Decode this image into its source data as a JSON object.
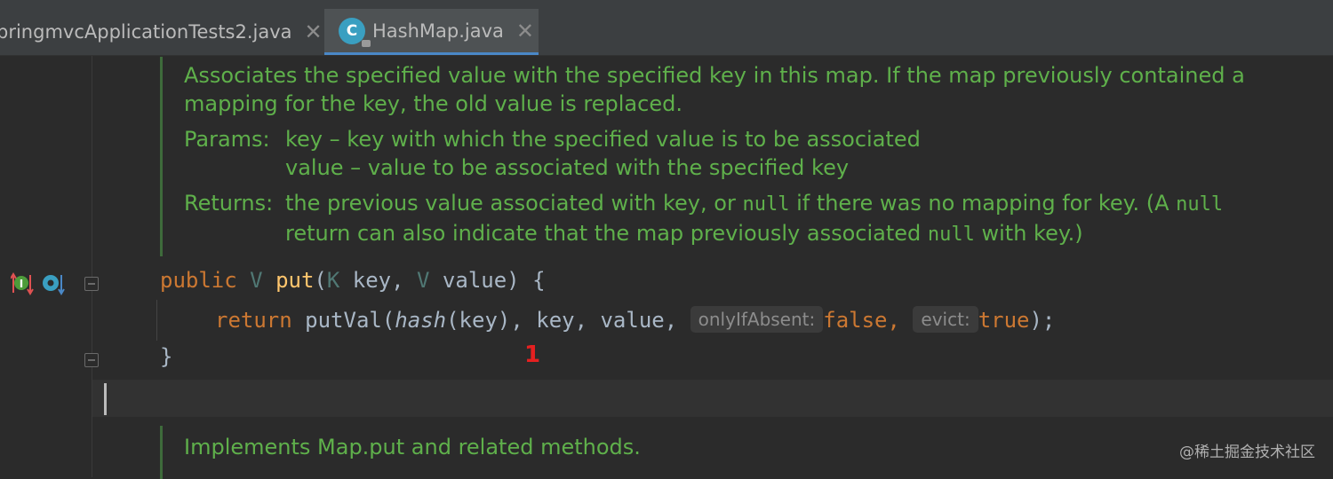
{
  "tabs": [
    {
      "label": "pringmvcApplicationTests2.java",
      "close": "✕"
    },
    {
      "label": "HashMap.java",
      "icon": "C",
      "close": "✕"
    }
  ],
  "doc1": {
    "line1": "Associates the specified value with the specified key in this map. If the map previously contained a",
    "line2": "mapping for the key, the old value is replaced.",
    "params_label": "Params:",
    "param1": "key – key with which the specified value is to be associated",
    "param2": "value – value to be associated with the specified key",
    "returns_label": "Returns:",
    "returns1_a": "the previous value associated with key, or ",
    "null1": "null",
    "returns1_b": " if there was no mapping for key. (A ",
    "null2": "null",
    "returns2_a": "return can also indicate that the map previously associated ",
    "null3": "null",
    "returns2_b": " with key.)"
  },
  "code": {
    "l1_public": "public",
    "l1_V": "V",
    "l1_put": "put",
    "l1_open": "(",
    "l1_K": "K",
    "l1_key": " key, ",
    "l1_V2": "V",
    "l1_rest": " value) {",
    "l2_return": "return",
    "l2_putVal": " putVal(",
    "l2_hash": "hash",
    "l2_args": "(key), key, value, ",
    "hint1": "onlyIfAbsent:",
    "l2_false": "false",
    "l2_comma": ", ",
    "hint2": "evict:",
    "l2_true": "true",
    "l2_end": ");",
    "l3_close": "}"
  },
  "marker": "1",
  "doc2": {
    "line1": "Implements Map.put and related methods."
  },
  "watermark": "@稀土掘金技术社区",
  "colors": {
    "doc": "#5fb04b",
    "keyword": "#cc7832",
    "method": "#ffc66d",
    "marker": "#e52020"
  }
}
